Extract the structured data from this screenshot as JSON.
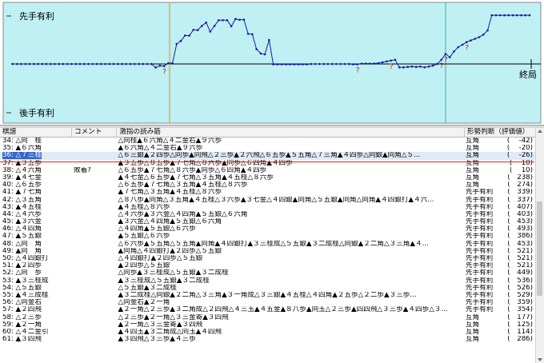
{
  "graph": {
    "label_top": "先手有利",
    "label_bottom": "後手有利",
    "label_end": "終局",
    "colors": {
      "bg": "#bff0f4",
      "line": "#1a1aa0",
      "cursor": "#e0a020",
      "marker": "#c01818",
      "grid": "#40b0b0"
    },
    "total_moves": 62,
    "current_move": 36,
    "markers": [
      36,
      82,
      90,
      102,
      103,
      108
    ],
    "evaluations": [
      0,
      0,
      0,
      0,
      0,
      0,
      0,
      0,
      0,
      0,
      0,
      0,
      0,
      0,
      0,
      0,
      0,
      0,
      0,
      0,
      0,
      0,
      0,
      0,
      0,
      0,
      0,
      0,
      0,
      0,
      0,
      0,
      0,
      0,
      -42,
      -20,
      -26,
      10,
      10,
      238,
      274,
      339,
      337,
      407,
      403,
      453,
      493,
      386,
      453,
      521,
      521,
      521,
      449,
      536,
      526,
      529,
      359,
      354,
      177,
      125,
      114,
      286,
      -5,
      -5,
      -5,
      -5,
      -5,
      -5,
      -5,
      -5,
      -5,
      0,
      0,
      0,
      0,
      0,
      0,
      0,
      0,
      0,
      0,
      -5,
      -5,
      5,
      5,
      5,
      5,
      10,
      20,
      30,
      40,
      50,
      -40,
      -40,
      -35,
      -30,
      -35,
      -30,
      -40,
      -30,
      -20,
      0,
      50,
      120,
      80,
      150,
      200,
      230,
      260,
      280,
      300,
      320,
      350,
      400,
      580,
      580,
      580,
      580,
      580,
      580,
      580,
      580,
      580,
      580
    ]
  },
  "table": {
    "headers": {
      "move": "棋譜",
      "comment": "コメント",
      "pv": "激指の読み筋",
      "judge": "形勢判断（評価値）"
    },
    "rows": [
      {
        "move": "34: △同　桂",
        "comment": "",
        "pv": "△同桂▲６六角△４二金右▲９六歩",
        "judge": "互角",
        "eval": "(　 -42)"
      },
      {
        "move": "35: ▲６六角",
        "comment": "",
        "pv": "▲６六角△４二金右▲９六歩",
        "judge": "互角",
        "eval": "(　 -20)"
      },
      {
        "move": "36: △７三桂",
        "comment": "",
        "pv": "△６三銀▲２四歩△同歩▲同飛△２三歩▲２六飛△６五歩▲５五角△７三角▲４四歩△同銀▲同角△５...",
        "judge": "互角",
        "eval": "(　 -26)"
      },
      {
        "move": "37: ▲３五歩",
        "comment": "",
        "pv": "▲３五歩△８五歩▲７七角△８六歩▲同歩△６四角▲４四歩",
        "judge": "互角",
        "eval": "(　 10)"
      },
      {
        "move": "38: △４六角",
        "comment": "敗着?",
        "pv": "△６五歩▲７七角△８六歩▲同歩△６四角▲４四歩",
        "judge": "互角",
        "eval": "(　 10)"
      },
      {
        "move": "39: ▲４七金",
        "comment": "",
        "pv": "▲４七金△６五歩▲７七角△３五角▲４五桂△８六歩",
        "judge": "互角",
        "eval": "(　238)"
      },
      {
        "move": "40: △６五歩",
        "comment": "",
        "pv": "△６五歩▲７七角△３五角▲４五桂△８六歩",
        "judge": "互角",
        "eval": "(　274)"
      },
      {
        "move": "41: ▲７七角",
        "comment": "",
        "pv": "▲７七角△３五角▲４五桂△８六歩",
        "judge": "先手有利",
        "eval": "(　339)"
      },
      {
        "move": "42: △３五角",
        "comment": "",
        "pv": "△８八歩▲同角△３五角▲４五桂△３六歩▲３七金△４四銀▲同角△５五銀▲同角△同角▲４四銀打▲４六...",
        "judge": "先手有利",
        "eval": "(　337)"
      },
      {
        "move": "43: ▲４五桂",
        "comment": "",
        "pv": "▲４五桂△８六歩",
        "judge": "先手有利",
        "eval": "(　407)"
      },
      {
        "move": "44: △４六歩",
        "comment": "",
        "pv": "△４六歩▲３六金△４四角▲５五銀△６六角",
        "judge": "先手有利",
        "eval": "(　403)"
      },
      {
        "move": "45: ▲３六金",
        "comment": "",
        "pv": "▲３六金△４四角▲５五銀△６六角",
        "judge": "先手有利",
        "eval": "(　453)"
      },
      {
        "move": "46: △４四角",
        "comment": "",
        "pv": "△４四角▲５五銀△６六歩",
        "judge": "先手有利",
        "eval": "(　493)"
      },
      {
        "move": "47: ▲５五銀",
        "comment": "",
        "pv": "▲５五銀△６六歩",
        "judge": "先手有利",
        "eval": "(　386)"
      },
      {
        "move": "48: △同　角",
        "comment": "",
        "pv": "△６六歩▲５五角△５五角▲同角▲４四銀打▲３三桂成△５五銀▲３二成桂△同銀▲２二角△３三角▲４...",
        "judge": "先手有利",
        "eval": "(　453)"
      },
      {
        "move": "49: ▲同　角",
        "comment": "",
        "pv": "▲同角△４四銀打▲２四歩△５五銀",
        "judge": "先手有利",
        "eval": "(　521)"
      },
      {
        "move": "50: △４四銀打",
        "comment": "",
        "pv": "△４四銀打▲２四歩△５五銀",
        "judge": "先手有利",
        "eval": "(　521)"
      },
      {
        "move": "51: ▲２四歩",
        "comment": "",
        "pv": "▲２四歩△５五銀",
        "judge": "先手有利",
        "eval": "(　521)"
      },
      {
        "move": "52: △同　歩",
        "comment": "",
        "pv": "△同歩▲３三桂成△５五銀▲３二成桂",
        "judge": "先手有利",
        "eval": "(　449)"
      },
      {
        "move": "53: ▲３三桂成",
        "comment": "",
        "pv": "▲３三桂成△５五銀▲３二成桂",
        "judge": "先手有利",
        "eval": "(　536)"
      },
      {
        "move": "54: △５五銀",
        "comment": "",
        "pv": "△５五銀▲３二成桂",
        "judge": "先手有利",
        "eval": "(　526)"
      },
      {
        "move": "55: ▲４三成桂",
        "comment": "",
        "pv": "▲３二成桂△同銀▲２二角△３三角▲３一角成△３三銀▲４五桂△４四角▲２五歩△２二歩▲３三歩...",
        "judge": "先手有利",
        "eval": "(　529)"
      },
      {
        "move": "56: △同金右",
        "comment": "",
        "pv": "△同金右▲２一角",
        "judge": "先手有利",
        "eval": "(　359)"
      },
      {
        "move": "57: ▲２四飛",
        "comment": "",
        "pv": "▲２一角△２三歩▲３二角成△２四飛△４三玉▲４五金▲８八歩▲同玉△２三歩▲四四飛△３三歩▲４四歩△３...",
        "judge": "先手有利",
        "eval": "(　354)"
      },
      {
        "move": "58: △２三歩",
        "comment": "",
        "pv": "△２三歩▲２一角△３三金寄▲３四飛",
        "judge": "互角",
        "eval": "(　177)"
      },
      {
        "move": "59: ▲２一角",
        "comment": "",
        "pv": "▲２一角△３三金寄▲３四飛",
        "judge": "互角",
        "eval": "(　125)"
      },
      {
        "move": "60: △４二金引",
        "comment": "",
        "pv": "▲４四玉▲３二角成△同玉▲４四飛",
        "judge": "互角",
        "eval": "(　114)"
      },
      {
        "move": "61: ▲３四飛",
        "comment": "",
        "pv": "▲３四飛△３三歩▲４三歩",
        "judge": "互角",
        "eval": "(　286)"
      }
    ]
  }
}
